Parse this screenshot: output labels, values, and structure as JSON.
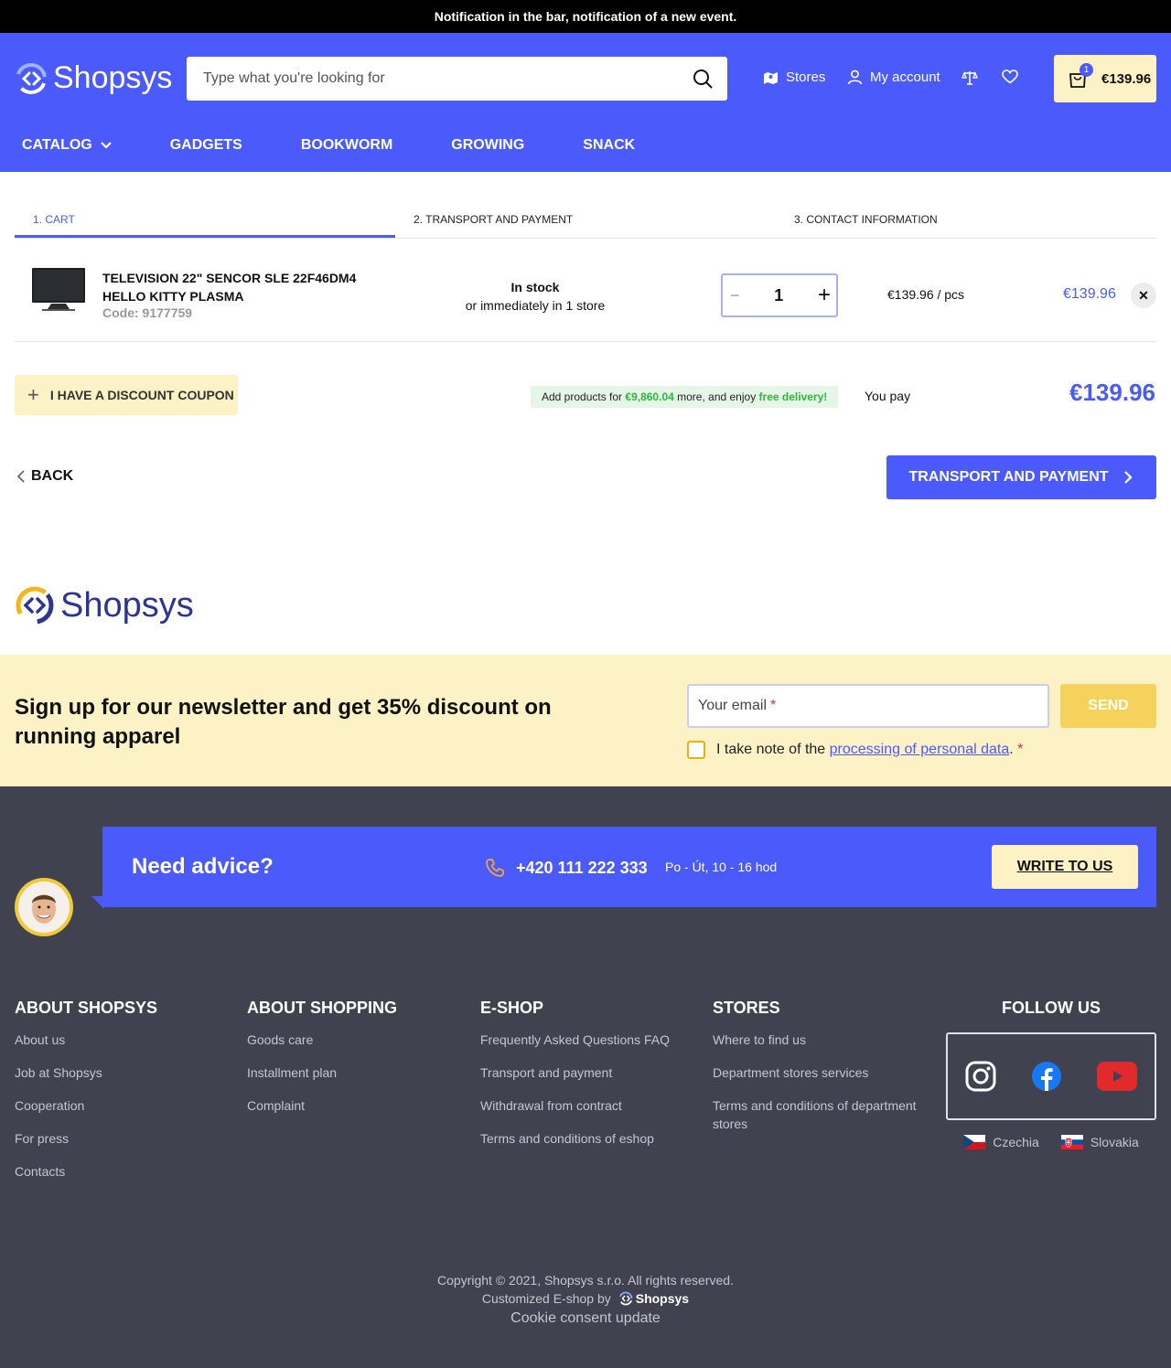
{
  "notification": "Notification in the bar, notification of a new event.",
  "header": {
    "logo_text": "Shopsys",
    "search_placeholder": "Type what you're looking for",
    "stores": "Stores",
    "account": "My account",
    "cart_count": "1",
    "cart_total": "€139.96"
  },
  "menu": [
    "CATALOG",
    "GADGETS",
    "BOOKWORM",
    "GROWING",
    "SNACK"
  ],
  "steps": [
    "1. CART",
    "2. TRANSPORT AND PAYMENT",
    "3. CONTACT INFORMATION"
  ],
  "cart_item": {
    "name": "TELEVISION 22\" SENCOR SLE 22F46DM4 HELLO KITTY PLASMA",
    "code": "Code: 9177759",
    "stock_status": "In stock",
    "stock_detail": "or immediately in 1 store",
    "quantity": "1",
    "unit_price": "€139.96 / pcs",
    "total": "€139.96"
  },
  "coupon_label": "I HAVE A DISCOUNT COUPON",
  "free_shipping": {
    "prefix": "Add products for",
    "amount": "€9,860.04",
    "middle": "more, and enjoy",
    "highlight": "free delivery!"
  },
  "you_pay_label": "You pay",
  "you_pay_amount": "€139.96",
  "back_label": "BACK",
  "next_label": "TRANSPORT AND PAYMENT",
  "newsletter": {
    "title": "Sign up for our newsletter and get 35% discount on running apparel",
    "email_placeholder": "Your email",
    "required_mark": "*",
    "send": "SEND",
    "consent_prefix": "I take note of the",
    "consent_link": "processing of personal data",
    "consent_suffix": "."
  },
  "advice": {
    "title": "Need advice?",
    "phone": "+420 111 222 333",
    "hours": "Po - Út, 10 - 16 hod",
    "write": "WRITE TO US"
  },
  "footer_columns": [
    {
      "title": "ABOUT SHOPSYS",
      "links": [
        "About us",
        "Job at Shopsys",
        "Cooperation",
        "For press",
        "Contacts"
      ]
    },
    {
      "title": "ABOUT SHOPPING",
      "links": [
        "Goods care",
        "Installment plan",
        "Complaint"
      ]
    },
    {
      "title": "E-SHOP",
      "links": [
        "Frequently Asked Questions FAQ",
        "Transport and payment",
        "Withdrawal from contract",
        "Terms and conditions of eshop"
      ]
    },
    {
      "title": "STORES",
      "links": [
        "Where to find us",
        "Department stores services",
        "Terms and conditions of department stores"
      ]
    }
  ],
  "follow": {
    "title": "FOLLOW US",
    "languages": [
      "Czechia",
      "Slovakia"
    ]
  },
  "copyright": "Copyright © 2021, Shopsys s.r.o. All rights reserved.",
  "customized_by": "Customized E-shop by",
  "cookie_update": "Cookie consent update",
  "colors": {
    "primary": "#4b5bfb",
    "accent": "#fdf1c6",
    "footer": "#41424f",
    "success": "#2bb83d"
  }
}
